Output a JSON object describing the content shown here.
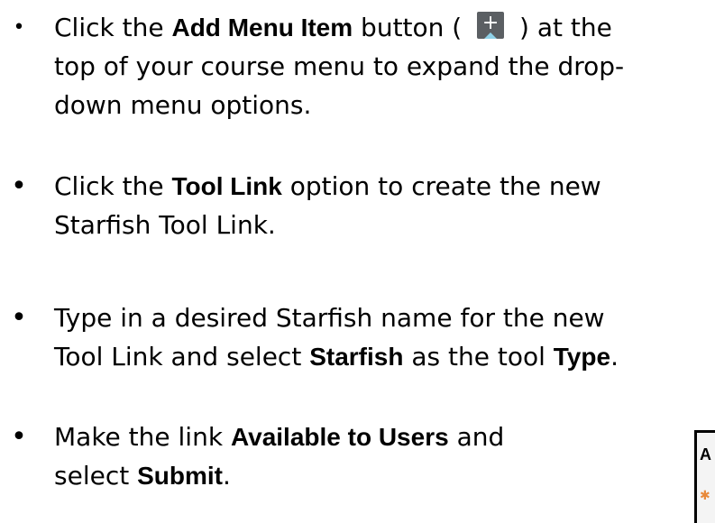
{
  "steps": [
    {
      "parts": [
        {
          "text": "Click the "
        },
        {
          "text": "Add Menu Item",
          "bold": true
        },
        {
          "text": " button ( "
        },
        {
          "icon": "add-menu-item-icon"
        },
        {
          "text": " ) at the"
        }
      ],
      "line2": "top of your course menu to expand the drop-",
      "line3": "down menu options."
    },
    {
      "parts": [
        {
          "text": "Click the "
        },
        {
          "text": "Tool Link",
          "bold": true
        },
        {
          "text": " option to create the new"
        }
      ],
      "line2": "Starfish Tool Link."
    },
    {
      "line1": "Type in a desired Starfish name for the new",
      "parts2": [
        {
          "text": "Tool Link and select "
        },
        {
          "text": "Starfish",
          "bold": true
        },
        {
          "text": " as the tool "
        },
        {
          "text": "Type",
          "bold": true
        },
        {
          "text": "."
        }
      ]
    },
    {
      "parts": [
        {
          "text": "Make the link "
        },
        {
          "text": "Available to Users",
          "bold": true
        },
        {
          "text": " and"
        }
      ],
      "parts2": [
        {
          "text": "select "
        },
        {
          "text": "Submit",
          "bold": true
        },
        {
          "text": "."
        }
      ]
    }
  ],
  "icon": {
    "plus": "+",
    "colors": {
      "button": "#5b5f63",
      "accent": "#8fd1e8"
    }
  },
  "screenshot_crop": {
    "letter": "A",
    "icon": "starfish-icon",
    "icon_glyph": "✱",
    "icon_color": "#e8893a"
  }
}
